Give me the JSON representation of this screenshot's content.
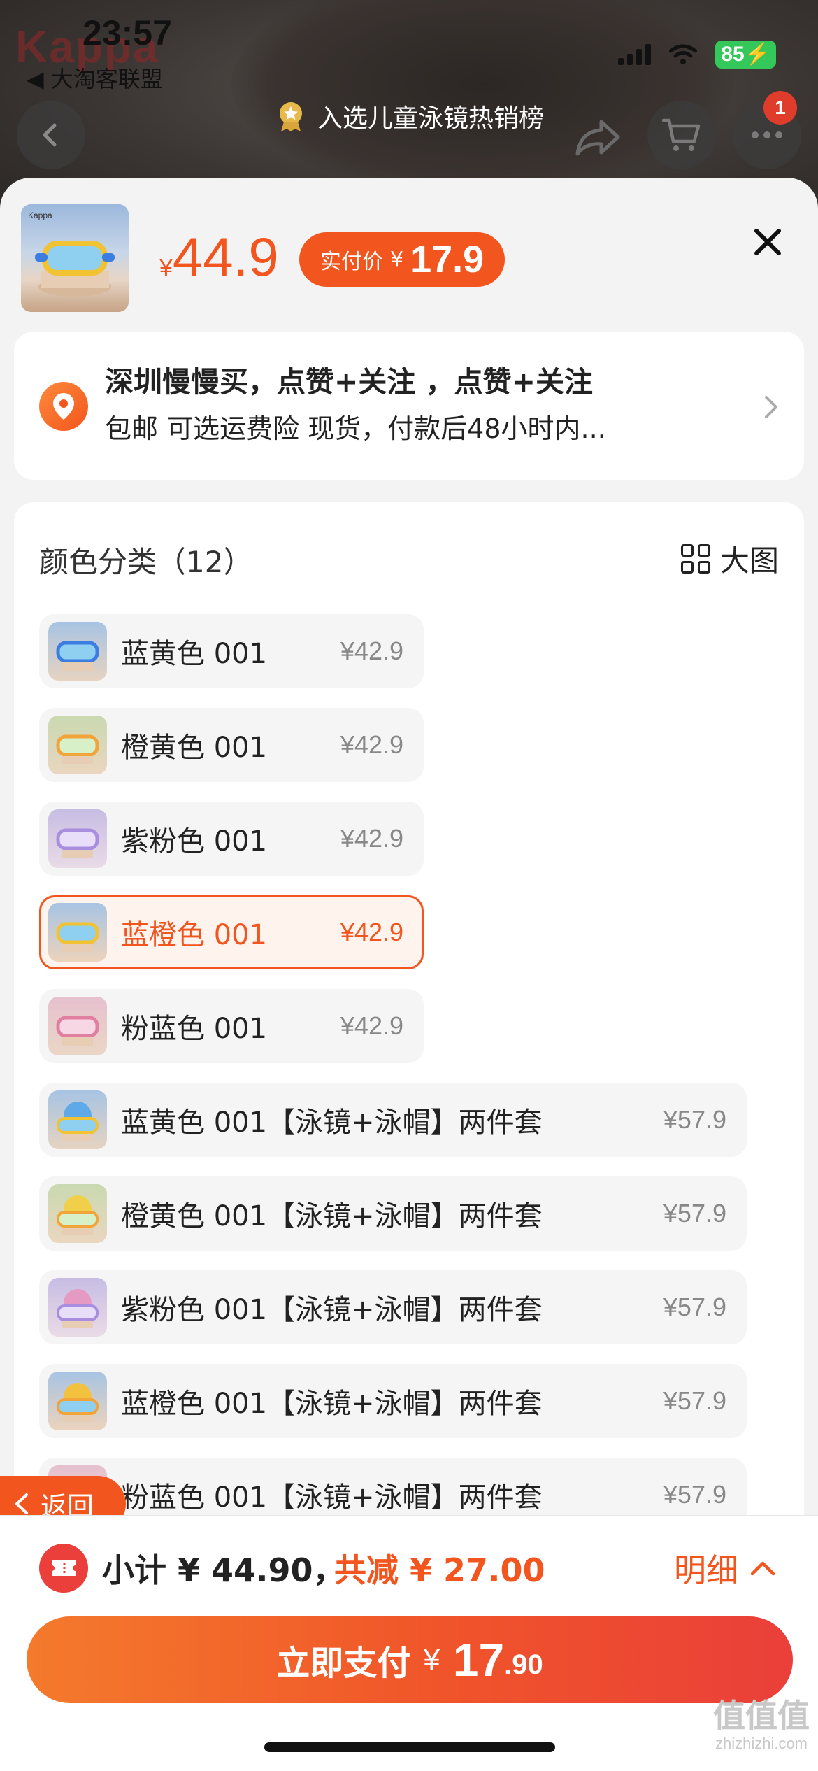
{
  "status": {
    "brand_ghost": "Kappa",
    "time": "23:57",
    "back_app": "◀ 大淘客联盟",
    "battery": "85"
  },
  "header": {
    "hot_badge": "入选儿童泳镜热销榜",
    "cart_count": "1"
  },
  "product": {
    "currency": "¥",
    "price": "44.9",
    "pay_label": "实付价",
    "pay_currency": "¥",
    "pay_price": "17.9",
    "close_icon": "close-icon"
  },
  "address": {
    "line1": "深圳慢慢买，点赞+关注 ，点赞+关注",
    "line2": "包邮  可选运费险  现货，付款后48小时内..."
  },
  "spec": {
    "title": "颜色分类（12）",
    "big_image_label": "大图",
    "options": [
      {
        "name": "蓝黄色 001",
        "price": "¥42.9",
        "selected": false
      },
      {
        "name": "橙黄色 001",
        "price": "¥42.9",
        "selected": false
      },
      {
        "name": "紫粉色 001",
        "price": "¥42.9",
        "selected": false
      },
      {
        "name": "蓝橙色 001",
        "price": "¥42.9",
        "selected": true
      },
      {
        "name": "粉蓝色 001",
        "price": "¥42.9",
        "selected": false
      },
      {
        "name": "蓝黄色 001【泳镜+泳帽】两件套",
        "price": "¥57.9",
        "selected": false
      },
      {
        "name": "橙黄色 001【泳镜+泳帽】两件套",
        "price": "¥57.9",
        "selected": false
      },
      {
        "name": "紫粉色 001【泳镜+泳帽】两件套",
        "price": "¥57.9",
        "selected": false
      },
      {
        "name": "蓝橙色 001【泳镜+泳帽】两件套",
        "price": "¥57.9",
        "selected": false
      },
      {
        "name": "粉蓝色 001【泳镜+泳帽】两件套",
        "price": "¥57.9",
        "selected": false
      }
    ]
  },
  "floating": {
    "back_label": "返回"
  },
  "footer": {
    "subtotal": "小计 ¥ 44.90，",
    "discount": "共减 ¥ 27.00",
    "detail": "明细",
    "pay_label": "立即支付",
    "pay_currency": "¥",
    "pay_int": "17",
    "pay_dec": ".90"
  },
  "watermark": {
    "main": "值值值",
    "sub": "zhizhizhi.com"
  },
  "colors": {
    "accent": "#f2551d",
    "pay_gradient_start": "#f47a2c",
    "pay_gradient_end": "#ea3f3a"
  }
}
